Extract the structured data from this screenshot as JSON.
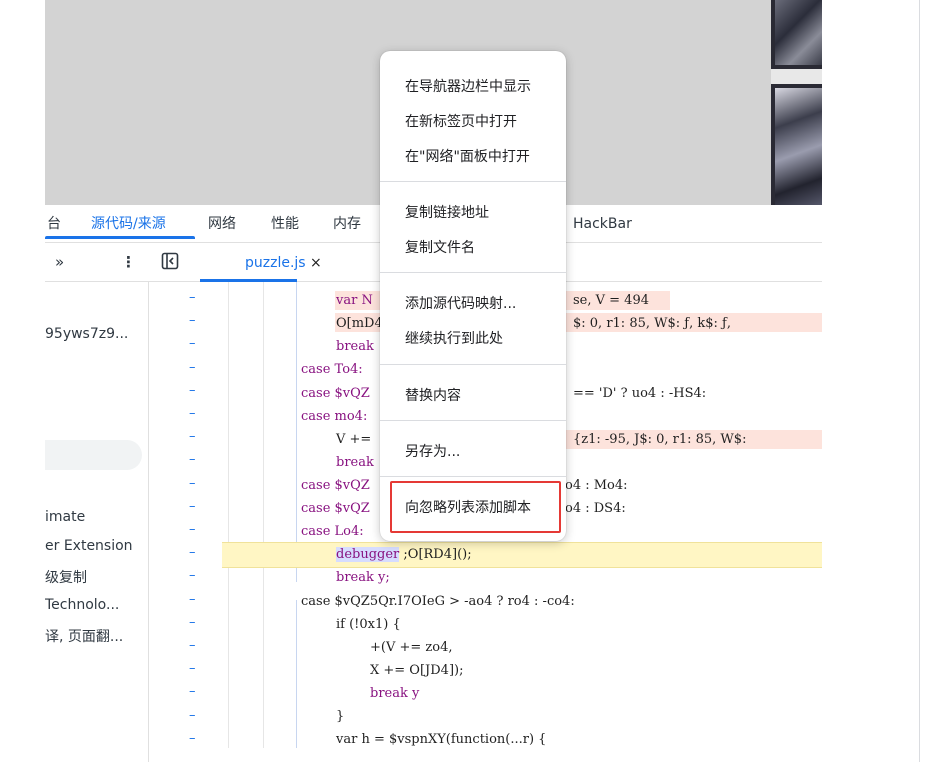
{
  "panel_tabs": [
    {
      "label": "台"
    },
    {
      "label": "源代码/来源"
    },
    {
      "label": "网络"
    },
    {
      "label": "性能"
    },
    {
      "label": "内存"
    },
    {
      "label": "HackBar"
    }
  ],
  "toolbar": {
    "more_chevron": "»",
    "kebab": "⋮",
    "file_tab": "puzzle.js",
    "file_close": "×"
  },
  "sidebar": {
    "items": [
      "95yws7z9...",
      "imate",
      "er Extension",
      "级复制",
      "Technolo...",
      "译, 页面翻..."
    ]
  },
  "code_lines": [
    {
      "text": "var N",
      "tail": "se, V = 494"
    },
    {
      "text": "O[mD4",
      "tail": "$: 0, r1: 85, W$: ƒ, k$: ƒ,"
    },
    {
      "text": "break"
    },
    {
      "text": "case To4:"
    },
    {
      "text": "case $vQZ",
      "tail": "== 'D' ? uo4 : -HS4:"
    },
    {
      "text": "case mo4:"
    },
    {
      "text": "V +=",
      "tail": "{z1: -95, J$: 0, r1: 85, W$:"
    },
    {
      "text": "break"
    },
    {
      "text": "case $vQZ",
      "tail": "o4 : Mo4:"
    },
    {
      "text": "case $vQZ",
      "tail": "o4 : DS4:"
    },
    {
      "text": "case Lo4:"
    },
    {
      "text": "debugger",
      "tail": ";O[RD4]();"
    },
    {
      "text": "break y;"
    },
    {
      "text": "case $vQZ5Qr.I7OIeG > -ao4 ? ro4 : -co4:"
    },
    {
      "text": "if (!0x1) {"
    },
    {
      "text": "+(V += zo4,"
    },
    {
      "text": "X += O[JD4]);"
    },
    {
      "text": "break y"
    },
    {
      "text": "}"
    },
    {
      "text": "var h = $vspnXY(function(...r) {"
    }
  ],
  "context_menu": {
    "items": [
      "在导航器边栏中显示",
      "在新标签页中打开",
      "在\"网络\"面板中打开",
      "复制链接地址",
      "复制文件名",
      "添加源代码映射...",
      "继续执行到此处",
      "替换内容",
      "另存为...",
      "向忽略列表添加脚本"
    ]
  },
  "colors": {
    "accent": "#1a73e8",
    "highlight_box": "#e53935",
    "paused_line": "#fff6c4"
  }
}
